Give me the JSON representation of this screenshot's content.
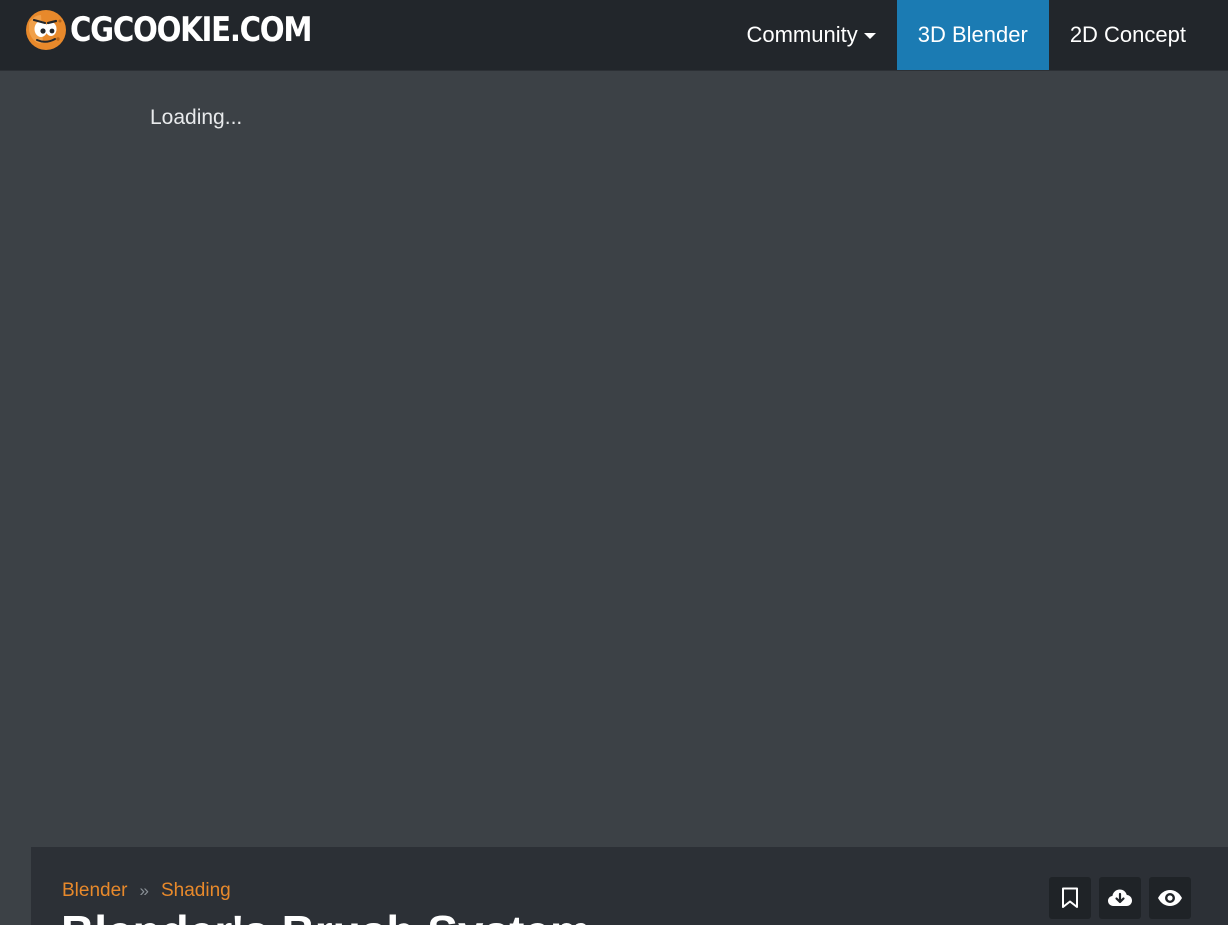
{
  "header": {
    "logo_text": "CGCOOKIE.COM",
    "nav": [
      {
        "label": "Community",
        "has_dropdown": true,
        "active": false
      },
      {
        "label": "3D Blender",
        "has_dropdown": false,
        "active": true
      },
      {
        "label": "2D Concept",
        "has_dropdown": false,
        "active": false
      }
    ]
  },
  "player": {
    "loading_text": "Loading..."
  },
  "lesson": {
    "breadcrumb": [
      "Blender",
      "Shading"
    ],
    "breadcrumb_separator": "»",
    "title": "Blender's Brush System",
    "actions": [
      {
        "icon": "bookmark-icon"
      },
      {
        "icon": "cloud-download-icon"
      },
      {
        "icon": "eye-icon"
      }
    ]
  },
  "colors": {
    "navbar_bg": "#22262b",
    "accent_blue": "#1b7bb3",
    "accent_orange": "#e8892b",
    "page_bg": "#3c4146",
    "panel_bg": "#2c3036"
  }
}
